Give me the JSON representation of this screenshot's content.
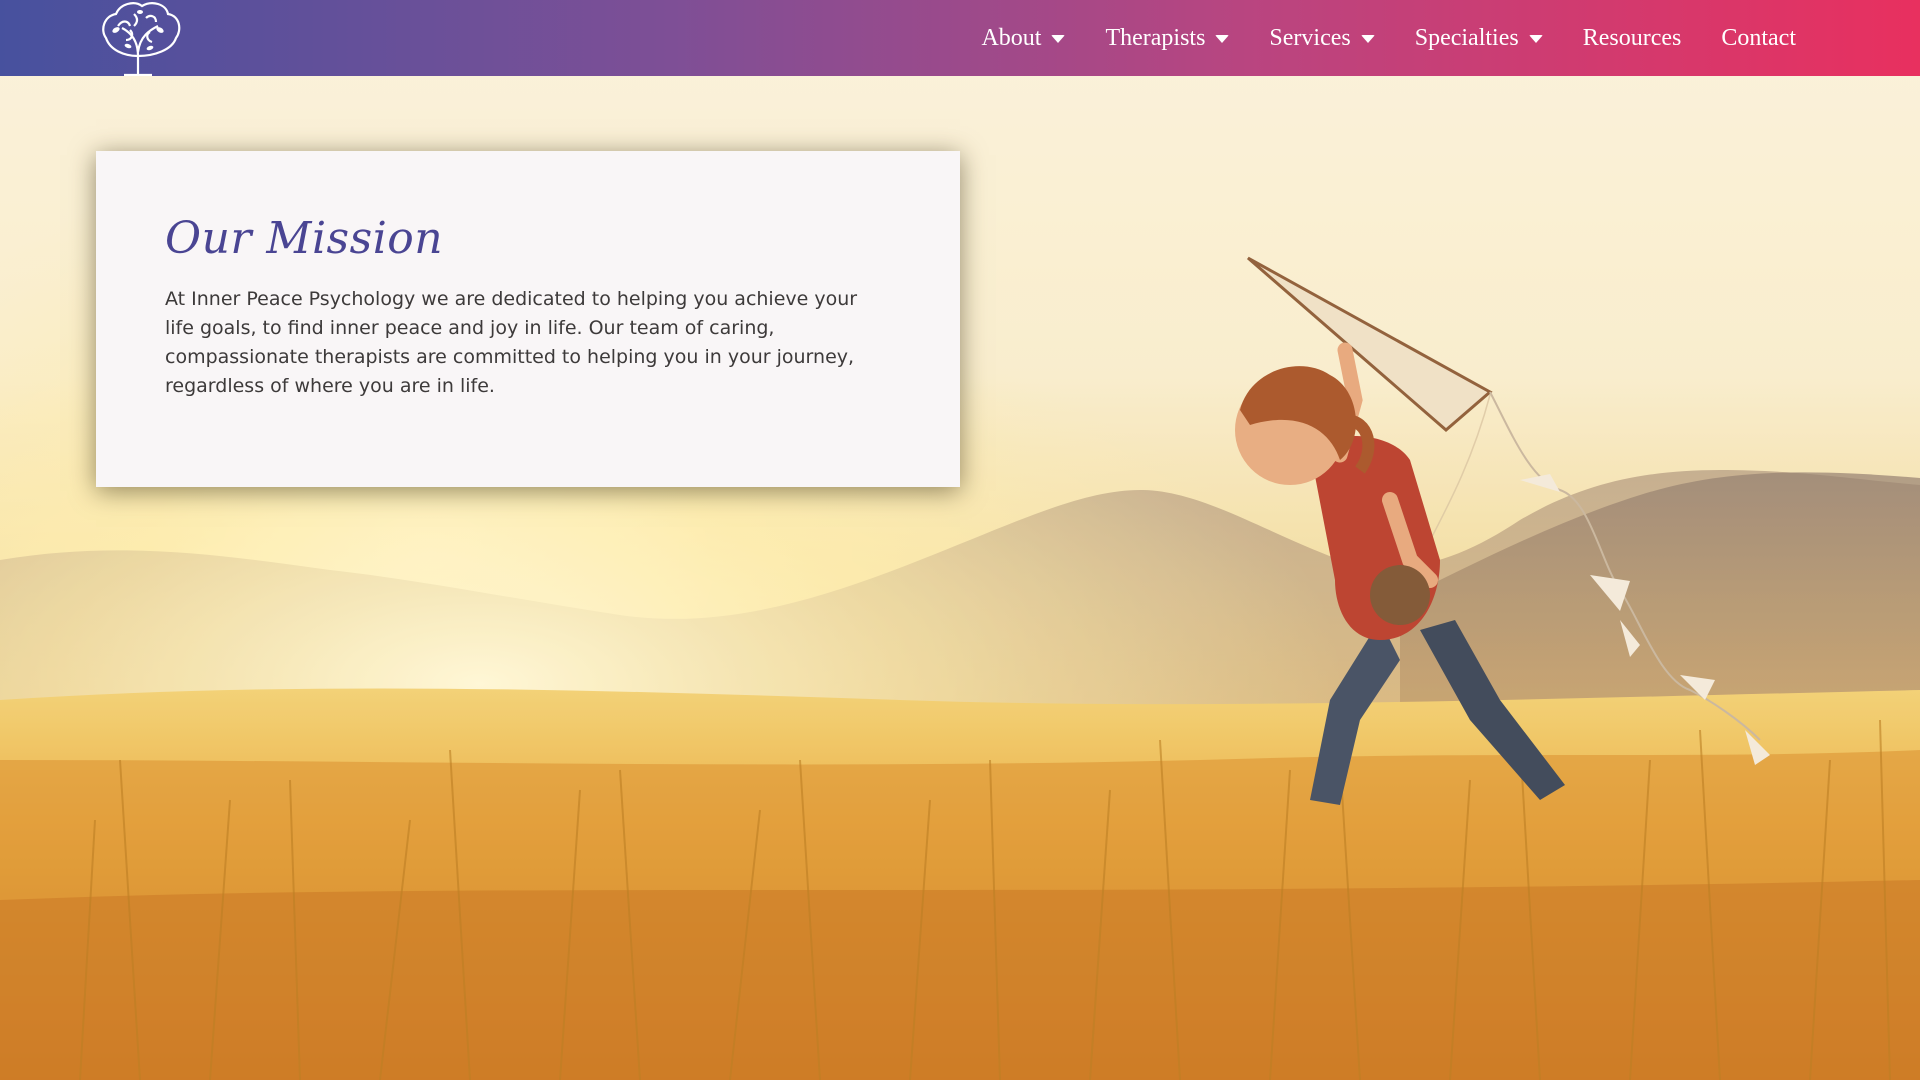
{
  "navbar": {
    "logo_icon": "tree-brain-icon",
    "items": [
      {
        "label": "About",
        "has_dropdown": true
      },
      {
        "label": "Therapists",
        "has_dropdown": true
      },
      {
        "label": "Services",
        "has_dropdown": true
      },
      {
        "label": "Specialties",
        "has_dropdown": true
      },
      {
        "label": "Resources",
        "has_dropdown": false
      },
      {
        "label": "Contact",
        "has_dropdown": false
      }
    ],
    "gradient_start": "#47519e",
    "gradient_end": "#e8305f"
  },
  "mission": {
    "title": "Our Mission",
    "body": "At Inner Peace Psychology we are dedicated to helping you achieve your life goals, to find inner peace and joy in life. Our team of caring, compassionate therapists are committed to helping you in your journey, regardless of where you are in life.",
    "title_color": "#4a4593"
  },
  "hero": {
    "image_subject": "child-running-with-kite-in-sunlit-field"
  }
}
